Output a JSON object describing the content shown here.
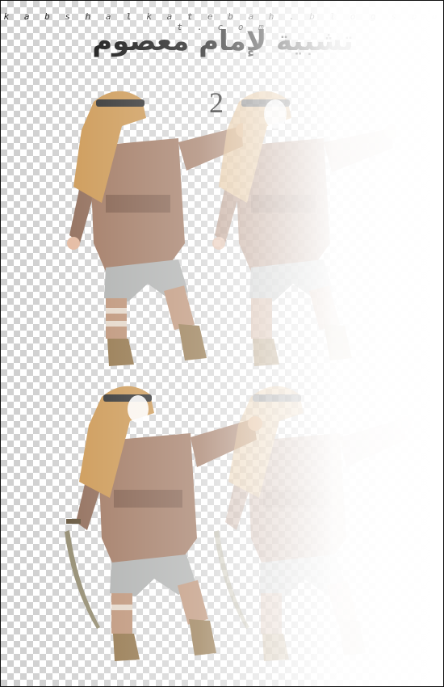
{
  "header": {
    "url_text": "k a b s h a l k a t e b a h . b l o g s p o t . c o m",
    "title": "تشبية لإمام معصوم",
    "number": "2"
  },
  "figures": [
    {
      "name": "boy-costume-top-left",
      "variant": "solid",
      "has_sword": false
    },
    {
      "name": "boy-costume-top-right",
      "variant": "faded",
      "has_sword": false
    },
    {
      "name": "boy-costume-bottom-left",
      "variant": "solid",
      "has_sword": true
    },
    {
      "name": "boy-costume-bottom-right",
      "variant": "faded",
      "has_sword": true
    }
  ],
  "colors": {
    "robe": "#9a6f57",
    "robe_dark": "#7a533f",
    "headscarf": "#c9924a",
    "band": "#222222",
    "pants": "#a8aaa9",
    "sock_a": "#b88a6c",
    "sock_b": "#e2d4c5",
    "boot": "#8a6a3c",
    "skin": "#e2b59a",
    "sword": "#8d8568"
  }
}
